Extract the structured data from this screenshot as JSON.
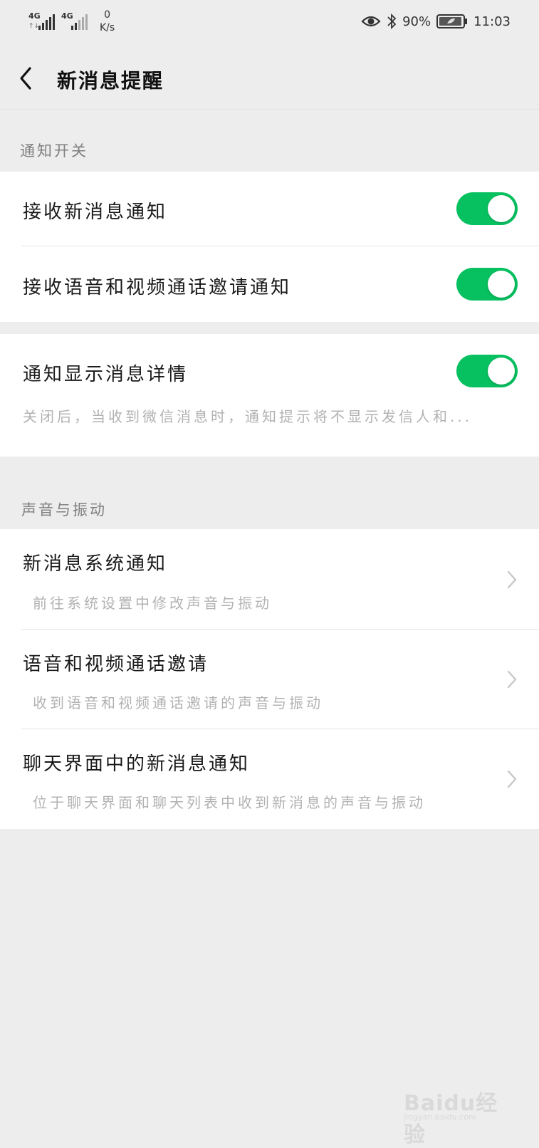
{
  "status_bar": {
    "signal1_label": "4G",
    "signal2_label": "4G",
    "data_arrows": "↑↓",
    "speed_value": "0",
    "speed_unit": "K/s",
    "battery_percent": "90%",
    "time": "11:03",
    "icons": [
      "eye-icon",
      "bluetooth-icon",
      "battery-icon"
    ]
  },
  "nav": {
    "back_icon": "chevron-left-icon",
    "title": "新消息提醒"
  },
  "sections": {
    "notification_switch_header": "通知开关",
    "sound_vibration_header": "声音与振动"
  },
  "rows": {
    "receive_new_msg": {
      "title": "接收新消息通知",
      "enabled": true
    },
    "receive_call_invite": {
      "title": "接收语音和视频通话邀请通知",
      "enabled": true
    },
    "show_msg_detail": {
      "title": "通知显示消息详情",
      "subtitle": "关闭后，当收到微信消息时，通知提示将不显示发信人和...",
      "enabled": true
    },
    "system_notification": {
      "title": "新消息系统通知",
      "subtitle": "前往系统设置中修改声音与振动"
    },
    "call_invite": {
      "title": "语音和视频通话邀请",
      "subtitle": "收到语音和视频通话邀请的声音与振动"
    },
    "chat_notification": {
      "title": "聊天界面中的新消息通知",
      "subtitle": "位于聊天界面和聊天列表中收到新消息的声音与振动"
    }
  },
  "colors": {
    "toggle_on": "#07c160",
    "background": "#ededed",
    "card": "#ffffff",
    "secondary_text": "#b2b2b2"
  },
  "watermark": {
    "brand": "Baidu经验",
    "url": "jingyan.baidu.com"
  }
}
